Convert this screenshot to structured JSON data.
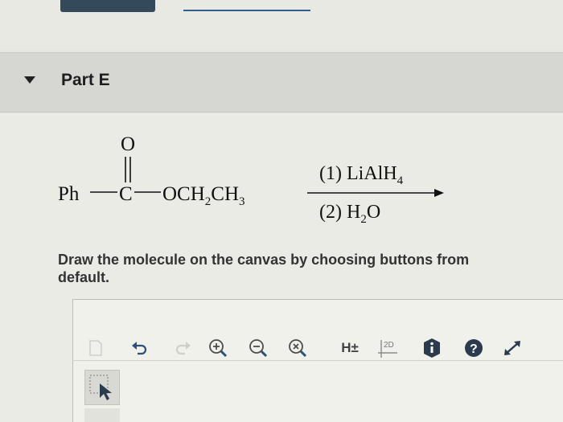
{
  "part": {
    "title": "Part E"
  },
  "reaction": {
    "reactant_left": "Ph",
    "carbonyl_oxygen": "O",
    "carbonyl_carbon": "C",
    "ester_group": "OCH",
    "ester_sub1": "2",
    "ester_ch3": "CH",
    "ester_sub2": "3",
    "step1_prefix": "(1) LiAlH",
    "step1_sub": "4",
    "step2_prefix": "(2) H",
    "step2_sub": "2",
    "step2_suffix": "O"
  },
  "instructions": {
    "line1": "Draw the molecule on the canvas by choosing buttons from",
    "line2": "default."
  },
  "toolbar": {
    "ht_label": "H±",
    "cleanup_label": "2D",
    "icons": [
      "clear-icon",
      "undo-icon",
      "redo-icon",
      "zoom-in-icon",
      "zoom-out-icon",
      "reset-zoom-icon",
      "explicit-hydrogens-icon",
      "clean-2d-icon",
      "info-icon",
      "help-icon",
      "expand-icon"
    ]
  }
}
